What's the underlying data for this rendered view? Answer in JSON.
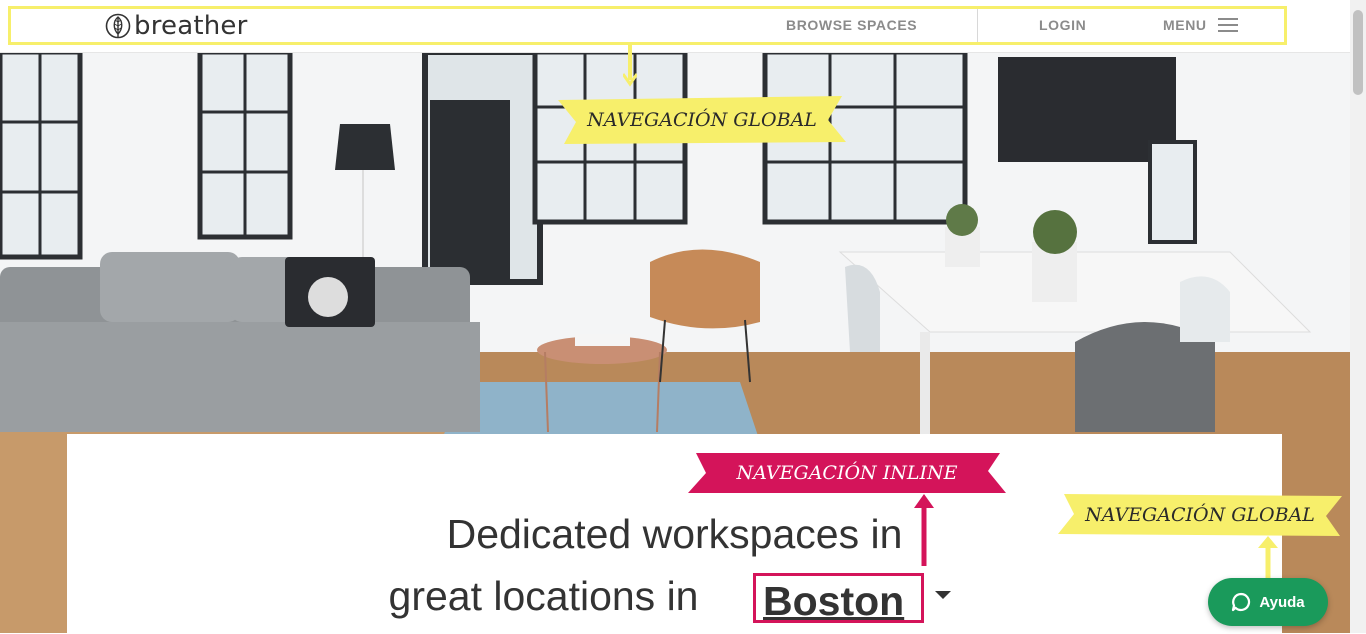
{
  "header": {
    "logo_text": "breather",
    "nav": {
      "browse": "BROWSE SPACES",
      "login": "LOGIN",
      "menu": "MENU"
    }
  },
  "annotations": {
    "global_top": "NAVEGACIÓN GLOBAL",
    "inline": "NAVEGACIÓN INLINE",
    "global_bottom": "NAVEGACIÓN GLOBAL"
  },
  "hero": {
    "line1": "Dedicated workspaces in",
    "line2": "great locations in",
    "city": "Boston"
  },
  "help": {
    "label": "Ayuda"
  },
  "colors": {
    "annotation_yellow": "#f7ef6b",
    "annotation_pink": "#d4145a",
    "help_green": "#1a9a5b",
    "nav_grey": "#8b8b8b"
  },
  "icons": {
    "logo": "tree-leaf-icon",
    "menu": "hamburger-icon",
    "dropdown": "caret-down-icon",
    "help": "chat-bubble-icon"
  }
}
